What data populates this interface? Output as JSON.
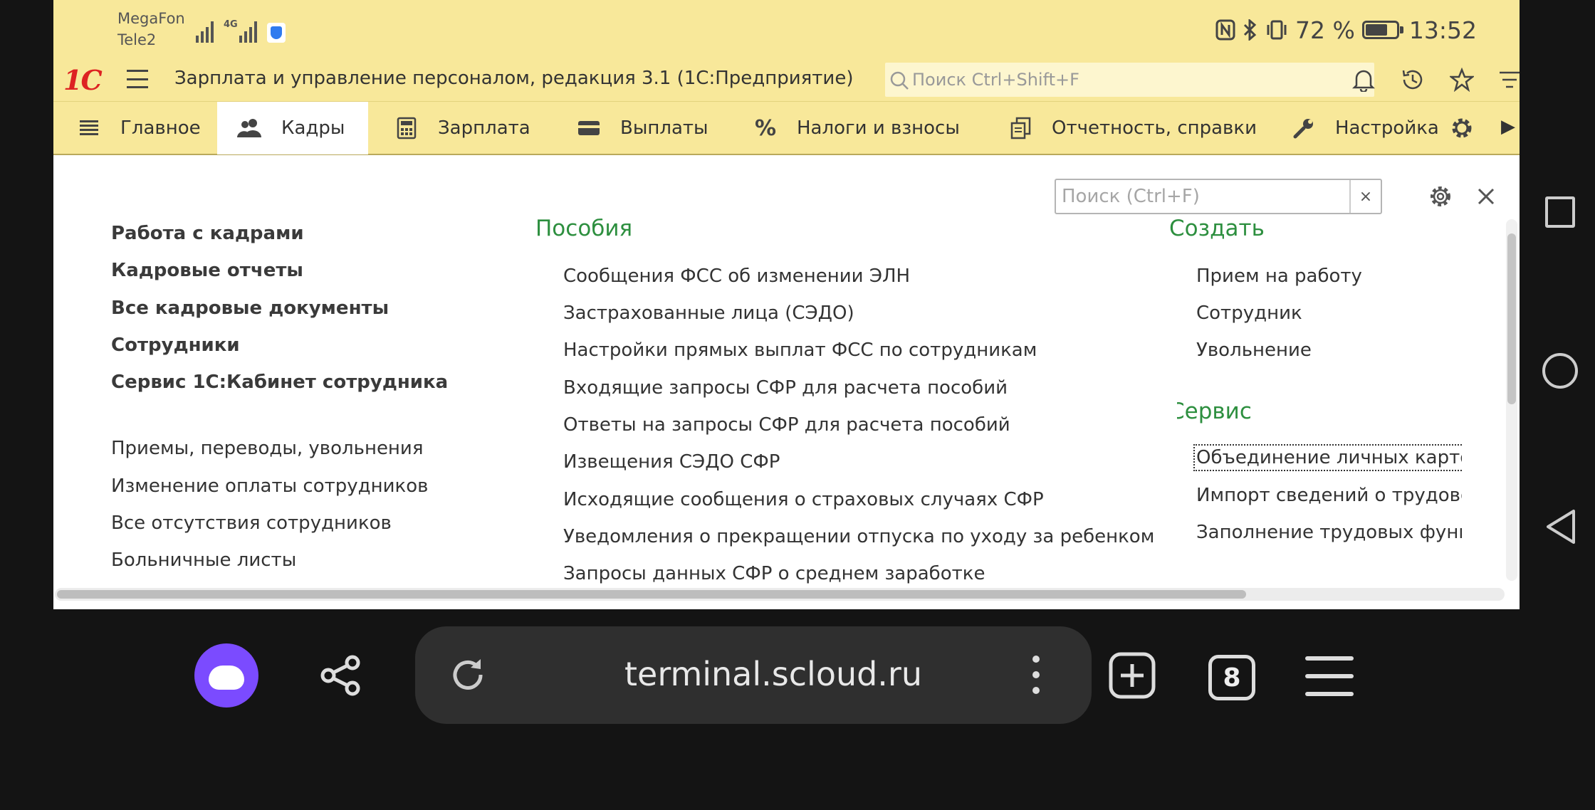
{
  "status_bar": {
    "carrier_1": "MegaFon",
    "carrier_2": "Tele2",
    "network_tag": "4G",
    "battery_text": "72 %",
    "battery_level": 0.72,
    "time": "13:52",
    "icons": [
      "nfc-icon",
      "bluetooth-icon",
      "vibrate-icon",
      "battery-icon"
    ]
  },
  "titlebar": {
    "logo": "1С",
    "title": "Зарплата и управление персоналом, редакция 3.1  (1С:Предприятие)",
    "search_placeholder": "Поиск Ctrl+Shift+F",
    "icons": [
      "bell-icon",
      "history-icon",
      "star-icon",
      "functions-menu-icon"
    ]
  },
  "sections": [
    {
      "label": "Главное",
      "icon": "list-icon"
    },
    {
      "label": "Кадры",
      "icon": "people-icon",
      "active": true
    },
    {
      "label": "Зарплата",
      "icon": "calculator-icon"
    },
    {
      "label": "Выплаты",
      "icon": "wallet-icon"
    },
    {
      "label": "Налоги и взносы",
      "icon": "percent-icon"
    },
    {
      "label": "Отчетность, справки",
      "icon": "reports-icon"
    },
    {
      "label": "Настройка",
      "icon": "wrench-icon"
    }
  ],
  "panel": {
    "find_placeholder": "Поиск (Ctrl+F)",
    "clear_glyph": "×",
    "left_bold": [
      "Работа с кадрами",
      "Кадровые отчеты",
      "Все кадровые документы",
      "Сотрудники",
      "Сервис 1С:Кабинет сотрудника"
    ],
    "left_regular": [
      "Приемы, переводы, увольнения",
      "Изменение оплаты сотрудников",
      "Все отсутствия сотрудников",
      "Больничные листы"
    ],
    "benefits": {
      "title": "Пособия",
      "items": [
        "Сообщения ФСС об изменении ЭЛН",
        "Застрахованные лица (СЭДО)",
        "Настройки прямых выплат ФСС по сотрудникам",
        "Входящие запросы СФР для расчета пособий",
        "Ответы на запросы СФР для расчета пособий",
        "Извещения СЭДО СФР",
        "Исходящие сообщения о страховых случаях СФР",
        "Уведомления о прекращении отпуска по уходу за ребенком",
        "Запросы данных СФР о среднем заработке"
      ]
    },
    "create": {
      "title": "Создать",
      "items": [
        "Прием на работу",
        "Сотрудник",
        "Увольнение"
      ]
    },
    "service": {
      "title": "Сервис",
      "items": [
        "Объединение личных карточек",
        "Импорт сведений о трудовой деятельности",
        "Заполнение трудовых функций в г"
      ]
    }
  },
  "browser": {
    "url": "terminal.scloud.ru",
    "tabs_count": "8"
  }
}
